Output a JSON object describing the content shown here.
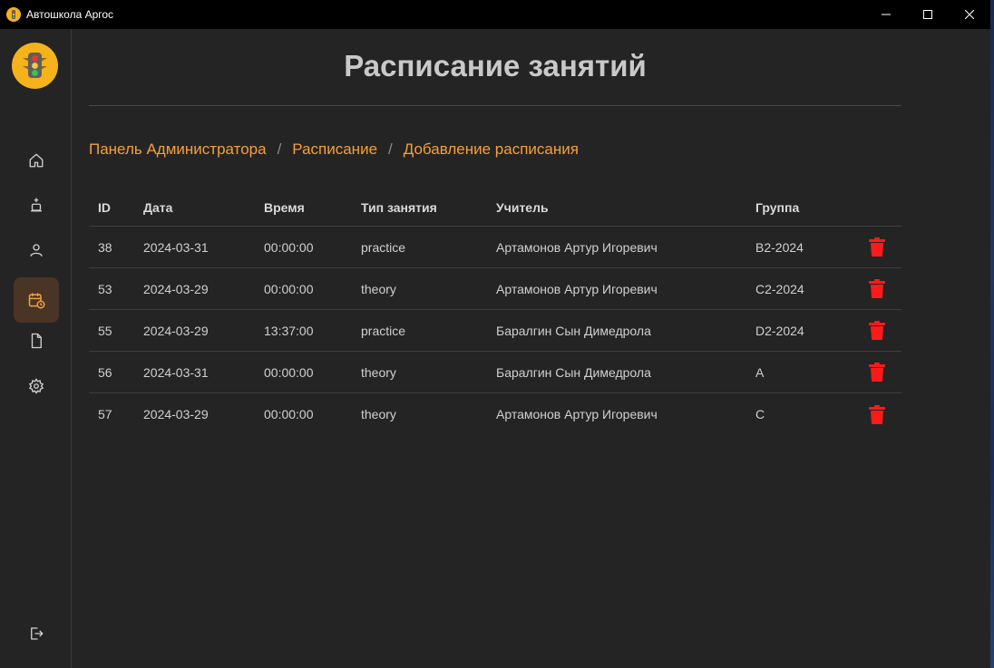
{
  "window": {
    "title": "Автошкола Аргос"
  },
  "colors": {
    "accent": "#f5a03a",
    "delete": "#ff1a1a",
    "active_nav_bg": "#4a3426",
    "background": "#242424"
  },
  "sidebar": {
    "items": [
      {
        "icon": "home-icon",
        "active": false
      },
      {
        "icon": "instructor-icon",
        "active": false
      },
      {
        "icon": "user-icon",
        "active": false
      },
      {
        "icon": "calendar-clock-icon",
        "active": true
      },
      {
        "icon": "document-icon",
        "active": false
      },
      {
        "icon": "gear-icon",
        "active": false
      }
    ],
    "logout_icon": "logout-icon"
  },
  "page": {
    "title": "Расписание занятий",
    "breadcrumb": [
      "Панель Администратора",
      "Расписание",
      "Добавление расписания"
    ],
    "breadcrumb_separator": "/"
  },
  "table": {
    "columns": [
      "ID",
      "Дата",
      "Время",
      "Тип занятия",
      "Учитель",
      "Группа"
    ],
    "rows": [
      {
        "id": "38",
        "date": "2024-03-31",
        "time": "00:00:00",
        "type": "practice",
        "teacher": "Артамонов Артур Игоревич",
        "group": "B2-2024"
      },
      {
        "id": "53",
        "date": "2024-03-29",
        "time": "00:00:00",
        "type": "theory",
        "teacher": "Артамонов Артур Игоревич",
        "group": "C2-2024"
      },
      {
        "id": "55",
        "date": "2024-03-29",
        "time": "13:37:00",
        "type": "practice",
        "teacher": "Баралгин Сын Димедрола",
        "group": "D2-2024"
      },
      {
        "id": "56",
        "date": "2024-03-31",
        "time": "00:00:00",
        "type": "theory",
        "teacher": "Баралгин Сын Димедрола",
        "group": "A"
      },
      {
        "id": "57",
        "date": "2024-03-29",
        "time": "00:00:00",
        "type": "theory",
        "teacher": "Артамонов Артур Игоревич",
        "group": "C"
      }
    ]
  }
}
